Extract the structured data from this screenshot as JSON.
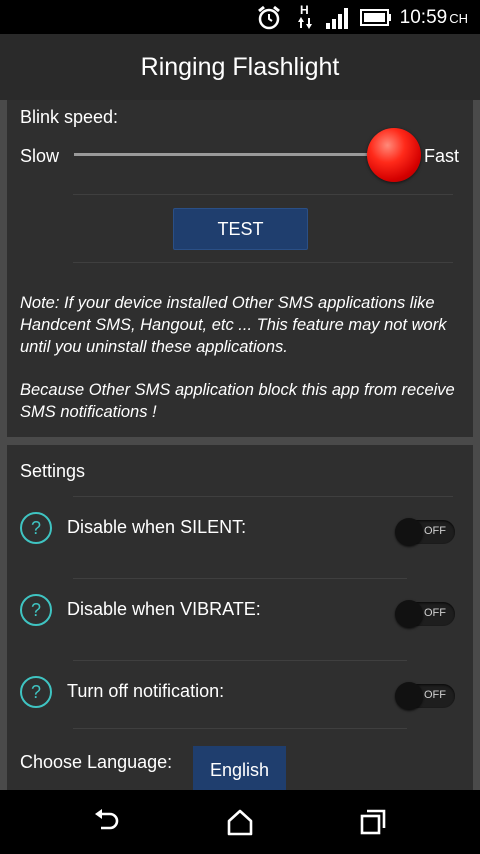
{
  "status_bar": {
    "network_label": "H",
    "time": "10:59",
    "time_suffix": "CH"
  },
  "action_bar": {
    "title": "Ringing Flashlight"
  },
  "blink": {
    "label": "Blink speed:",
    "min_label": "Slow",
    "max_label": "Fast",
    "value_fraction": 1.0
  },
  "test_button": {
    "label": "TEST"
  },
  "note": {
    "paragraph1": "Note: If your device installed Other SMS applications like Handcent SMS, Hangout, etc ... This feature may not work until you uninstall these applications.",
    "paragraph2": "Because Other SMS application block this app from receive SMS notifications !"
  },
  "settings": {
    "title": "Settings",
    "items": [
      {
        "help": "?",
        "label": "Disable when SILENT:",
        "state": "OFF"
      },
      {
        "help": "?",
        "label": "Disable when VIBRATE:",
        "state": "OFF"
      },
      {
        "help": "?",
        "label": "Turn off notification:",
        "state": "OFF"
      }
    ],
    "language_label": "Choose Language:",
    "language_value": "English"
  },
  "icons": {
    "alarm": "alarm-clock-icon",
    "data": "data-arrows-icon",
    "signal": "signal-bars-icon",
    "battery": "battery-icon",
    "back": "back-icon",
    "home": "home-icon",
    "recents": "recents-icon"
  },
  "colors": {
    "accent": "#3fc4c2",
    "button": "#1f3e6e",
    "slider_thumb": "#e00000",
    "card": "#2f2f2f",
    "background": "#4a4a4a"
  }
}
